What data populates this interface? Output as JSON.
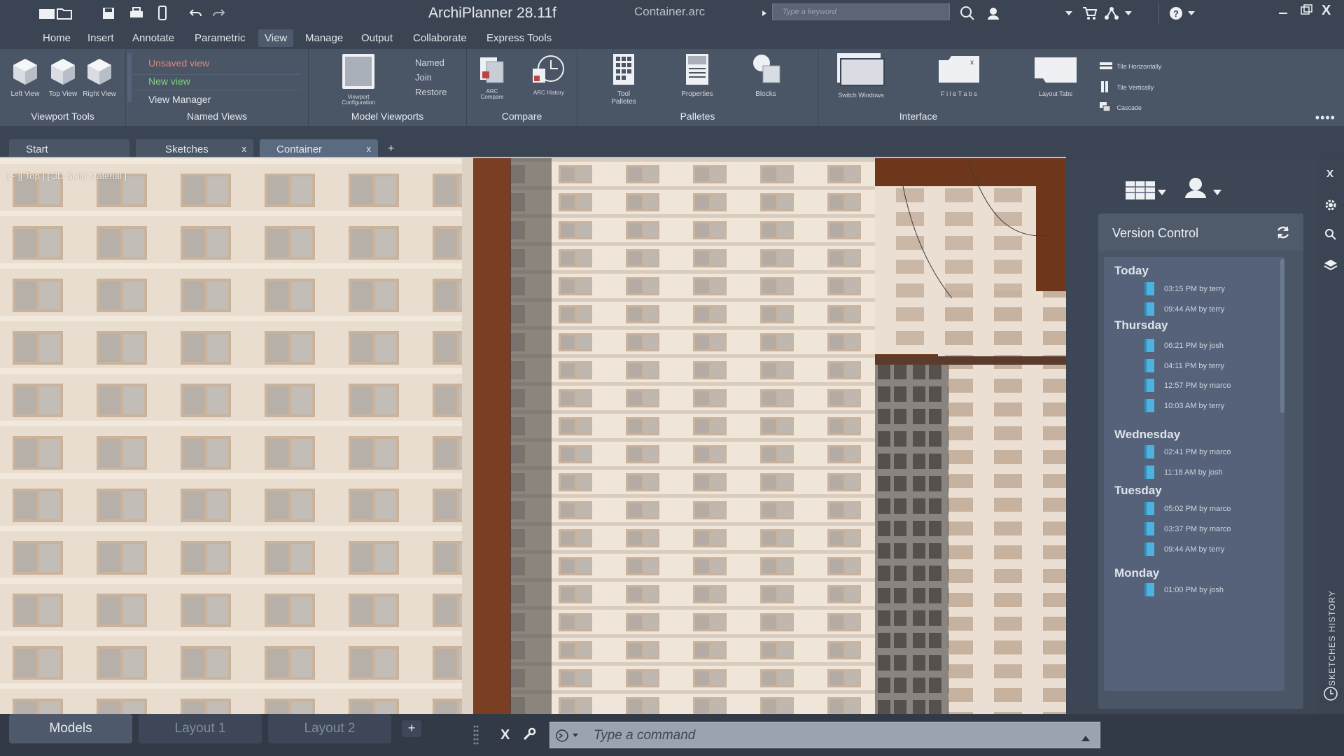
{
  "titlebar": {
    "app_title": "ArchiPlanner 28.11f",
    "file_title": "Container.arc",
    "search_placeholder": "Type a keyword",
    "close_label": "X"
  },
  "menu": {
    "items": [
      "Home",
      "Insert",
      "Annotate",
      "Parametric",
      "View",
      "Manage",
      "Output",
      "Collaborate",
      "Express Tools"
    ],
    "active": "View"
  },
  "ribbon": {
    "viewport_tools": {
      "label": "Viewport Tools",
      "left": "Left View",
      "top": "Top View",
      "right": "Right View"
    },
    "named_views": {
      "label": "Named Views",
      "unsaved": "Unsaved view",
      "new": "New view",
      "manager": "View Manager"
    },
    "model_viewports": {
      "label": "Model Viewports",
      "config": "Viewport Configuration",
      "named": "Named",
      "join": "Join",
      "restore": "Restore"
    },
    "compare": {
      "label": "Compare",
      "arc_compare": "ARC Compare",
      "arc_history": "ARC History"
    },
    "palettes": {
      "label": "Palletes",
      "tool": "Tool Palletes",
      "properties": "Properties",
      "blocks": "Blocks"
    },
    "interface": {
      "label": "Interface",
      "switch": "Switch Windows",
      "file_tabs": "F i l e  T a b s",
      "layout_tabs": "Layout Tabs",
      "tile_h": "Tile Horizontally",
      "tile_v": "Tile Vertically",
      "cascade": "Cascade"
    },
    "more": "••••"
  },
  "doc_tabs": [
    {
      "label": "Start",
      "closable": false
    },
    {
      "label": "Sketches",
      "closable": true
    },
    {
      "label": "Container",
      "closable": true
    }
  ],
  "viewport": {
    "label": "[ - ][ Top ] [ 3D Solid Material ]"
  },
  "version_control": {
    "title": "Version Control",
    "groups": [
      {
        "day": "Today",
        "entries": [
          "03:15 PM by terry",
          "09:44 AM by terry"
        ]
      },
      {
        "day": "Thursday",
        "entries": [
          "06:21 PM by josh",
          "04:11 PM by terry",
          "12:57 PM by marco",
          "10:03 AM by terry"
        ]
      },
      {
        "day": "Wednesday",
        "entries": [
          "02:41 PM by marco",
          "11:18 AM by josh"
        ]
      },
      {
        "day": "Tuesday",
        "entries": [
          "05:02 PM by marco",
          "03:37 PM by marco",
          "09:44 AM by terry"
        ]
      },
      {
        "day": "Monday",
        "entries": [
          "01:00 PM by josh"
        ]
      }
    ]
  },
  "side": {
    "close": "X",
    "vertical_tab": "SKETCHES HISTORY"
  },
  "bottom": {
    "layout_tabs": [
      "Models",
      "Layout 1",
      "Layout 2"
    ],
    "active_layout": "Models",
    "cmd_close": "X",
    "cmd_placeholder": "Type a command"
  },
  "colors": {
    "accent": "#4db3de",
    "unsaved_view": "#e0857a",
    "new_view": "#7fd07a"
  }
}
